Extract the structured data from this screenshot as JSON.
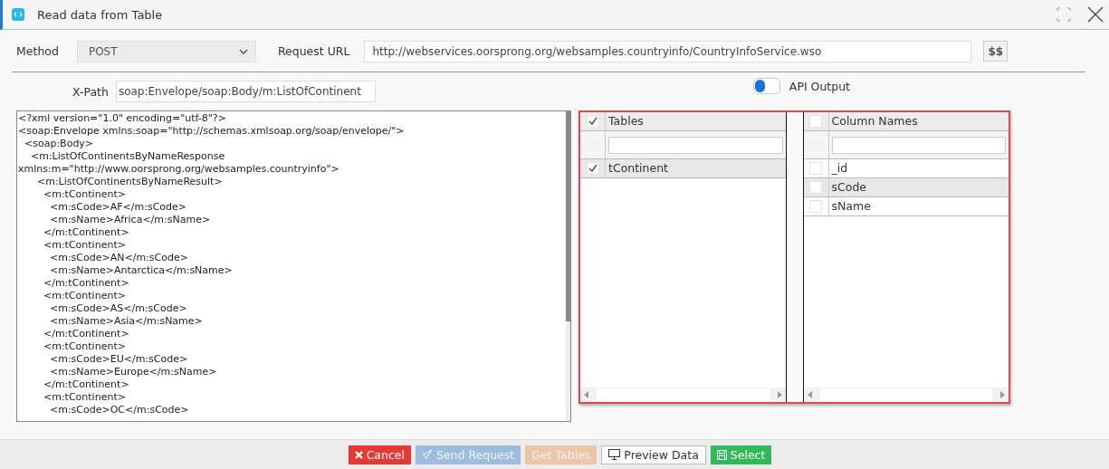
{
  "window": {
    "title": "Read data from Table"
  },
  "method": {
    "label": "Method",
    "value": "POST"
  },
  "request_url": {
    "label": "Request URL",
    "value": "http://webservices.oorsprong.org/websamples.countryinfo/CountryInfoService.wso",
    "button": "$$"
  },
  "xpath": {
    "label": "X-Path",
    "value": "soap:Envelope/soap:Body/m:ListOfContinent"
  },
  "api_output": {
    "label": "API Output",
    "on": false
  },
  "response": [
    "<?xml version=\"1.0\" encoding=\"utf-8\"?>",
    "<soap:Envelope xmlns:soap=\"http://schemas.xmlsoap.org/soap/envelope/\">",
    "  <soap:Body>",
    "    <m:ListOfContinentsByNameResponse",
    "xmlns:m=\"http://www.oorsprong.org/websamples.countryinfo\">",
    "      <m:ListOfContinentsByNameResult>",
    "        <m:tContinent>",
    "          <m:sCode>AF</m:sCode>",
    "          <m:sName>Africa</m:sName>",
    "        </m:tContinent>",
    "        <m:tContinent>",
    "          <m:sCode>AN</m:sCode>",
    "          <m:sName>Antarctica</m:sName>",
    "        </m:tContinent>",
    "        <m:tContinent>",
    "          <m:sCode>AS</m:sCode>",
    "          <m:sName>Asia</m:sName>",
    "        </m:tContinent>",
    "        <m:tContinent>",
    "          <m:sCode>EU</m:sCode>",
    "          <m:sName>Europe</m:sName>",
    "        </m:tContinent>",
    "        <m:tContinent>",
    "          <m:sCode>OC</m:sCode>"
  ],
  "tables": {
    "header": "Tables",
    "header_checked": true,
    "rows": [
      {
        "name": "tContinent",
        "checked": true,
        "selected": true
      }
    ]
  },
  "columns": {
    "header": "Column Names",
    "header_checked": false,
    "rows": [
      {
        "name": "_id",
        "checked": false,
        "selected": false
      },
      {
        "name": "sCode",
        "checked": false,
        "selected": true
      },
      {
        "name": "sName",
        "checked": false,
        "selected": false
      }
    ]
  },
  "buttons": [
    {
      "label": "Cancel",
      "kind": "cancel",
      "disabled": false
    },
    {
      "label": "Send Request",
      "kind": "send",
      "disabled": true
    },
    {
      "label": "Get Tables",
      "kind": "tables",
      "disabled": true
    },
    {
      "label": "Preview Data",
      "kind": "preview",
      "disabled": false
    },
    {
      "label": "Select",
      "kind": "select",
      "disabled": false
    }
  ]
}
